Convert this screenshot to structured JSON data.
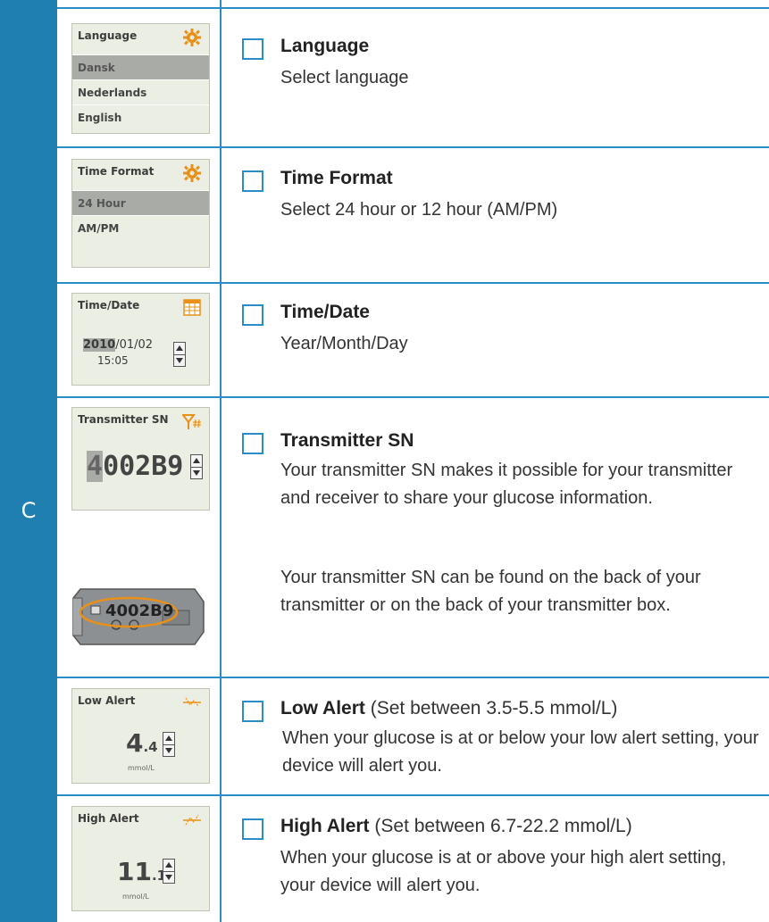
{
  "section": {
    "letter": "C"
  },
  "rows": [
    {
      "screen": {
        "title": "Language",
        "icon": "gear-icon",
        "items": [
          "Dansk",
          "Nederlands",
          "English"
        ],
        "selected_index": 0
      },
      "heading": "Language",
      "description": "Select language"
    },
    {
      "screen": {
        "title": "Time Format",
        "icon": "gear-icon",
        "items": [
          "24 Hour",
          "AM/PM"
        ],
        "selected_index": 0
      },
      "heading": "Time Format",
      "description": "Select 24 hour or 12 hour (AM/PM)"
    },
    {
      "screen": {
        "title": "Time/Date",
        "icon": "calendar-icon",
        "year": "2010",
        "date_rest": "/01/02",
        "time": "15:05"
      },
      "heading": "Time/Date",
      "description": "Year/Month/Day"
    },
    {
      "screen": {
        "title": "Transmitter SN",
        "icon": "antenna-hash-icon",
        "sn_first": "4",
        "sn_rest": "002B9",
        "device_label": "4002B9"
      },
      "heading": "Transmitter SN",
      "description_1": "Your transmitter SN makes it possible for your transmitter and receiver to share your glucose information.",
      "description_2": "Your transmitter SN can be found on the back of your transmitter or on the back of your transmitter box."
    },
    {
      "screen": {
        "title": "Low Alert",
        "icon": "low-alert-icon",
        "value_main": "4",
        "value_dec": ".4",
        "unit": "mmol/L"
      },
      "heading": "Low Alert",
      "heading_note": "(Set between 3.5-5.5 mmol/L)",
      "description": "When your glucose is at or below your low alert setting, your device will alert you."
    },
    {
      "screen": {
        "title": "High Alert",
        "icon": "high-alert-icon",
        "value_main": "11",
        "value_dec": ".1",
        "unit": "mmol/L"
      },
      "heading": "High Alert",
      "heading_note": "(Set between 6.7-22.2 mmol/L)",
      "description": "When your glucose is at or above your high alert setting, your device will alert you."
    }
  ],
  "colors": {
    "section_bar": "#1e7fb0",
    "lines": "#2a8dc5",
    "screen_bg": "#ebefe3",
    "selection": "#a9aca6",
    "gear_icon": "#e8901a",
    "device_circle": "#e8901a"
  }
}
